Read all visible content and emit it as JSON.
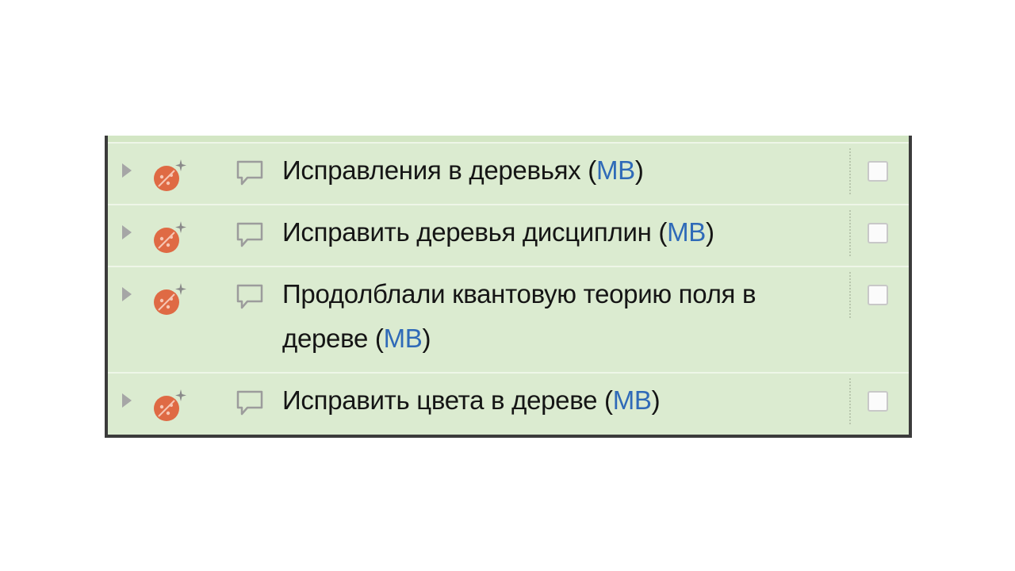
{
  "tasks": [
    {
      "title": "Исправления в деревьях",
      "open_paren": "(",
      "assignee": "MB",
      "close_paren": ")",
      "checked": false,
      "icon": "ladybug-icon"
    },
    {
      "title": "Исправить деревья дисциплин",
      "open_paren": "(",
      "assignee": "MB",
      "close_paren": ")",
      "checked": false,
      "icon": "ladybug-icon"
    },
    {
      "title": "Продолблали квантовую теорию поля в дереве",
      "open_paren": "(",
      "assignee": "MB",
      "close_paren": ")",
      "checked": false,
      "icon": "ladybug-icon"
    },
    {
      "title": "Исправить цвета в дереве",
      "open_paren": "(",
      "assignee": "MB",
      "close_paren": ")",
      "checked": false,
      "icon": "ladybug-icon"
    }
  ],
  "colors": {
    "row_background": "#dbebd0",
    "bug_icon": "#df6a44",
    "assignee_link": "#2f6ab8",
    "frame": "#3b3b3b"
  }
}
